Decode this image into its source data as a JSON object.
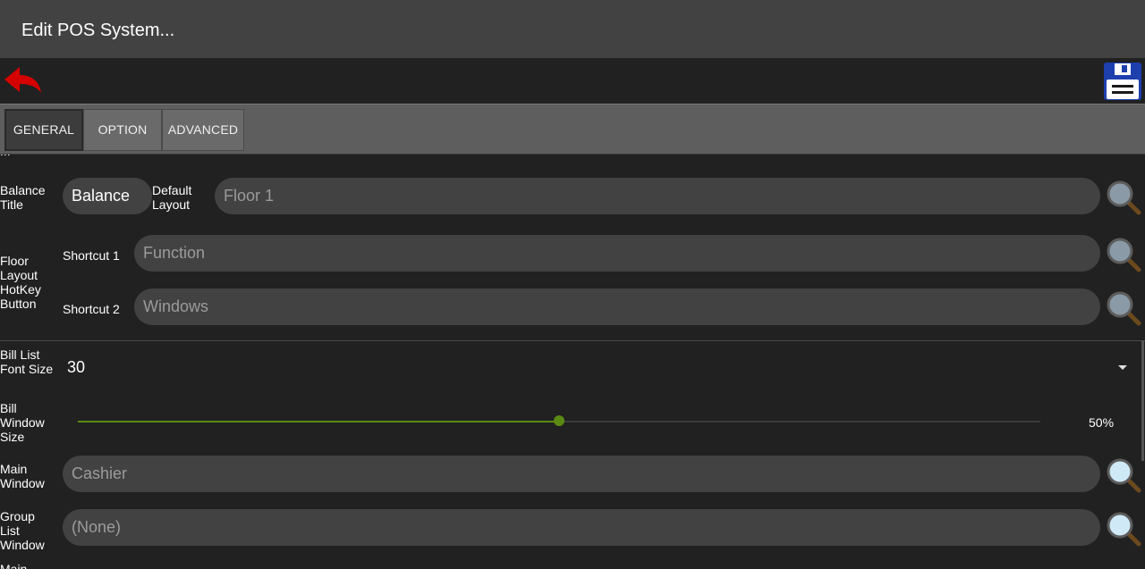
{
  "window": {
    "title": "Edit POS System..."
  },
  "toolbar": {
    "back_icon": "back-arrow-icon",
    "save_icon": "floppy-disk-icon",
    "back_color": "#d50000",
    "save_color": "#1e3fae"
  },
  "tabs": [
    {
      "label": "GENERAL",
      "active": true
    },
    {
      "label": "OPTION",
      "active": false
    },
    {
      "label": "ADVANCED",
      "active": false
    }
  ],
  "form": {
    "cut_off_text": "...",
    "balance_title": {
      "label": "Balance\nTitle",
      "value": "Balance"
    },
    "default_layout": {
      "label": "Default\nLayout",
      "placeholder": "Floor 1"
    },
    "floor_layout_hotkey": {
      "label": "Floor\nLayout\nHotKey\nButton",
      "shortcut1": {
        "label": "Shortcut 1",
        "placeholder": "Function"
      },
      "shortcut2": {
        "label": "Shortcut 2",
        "placeholder": "Windows"
      }
    },
    "bill_list_font_size": {
      "label": "Bill List\nFont Size",
      "value": "30"
    },
    "bill_window_size": {
      "label": "Bill\nWindow\nSize",
      "value_percent": 50,
      "value_text": "50%",
      "accent": "#5b8a13"
    },
    "main_window": {
      "label": "Main\nWindow",
      "placeholder": "Cashier"
    },
    "group_list_window": {
      "label": "Group\nList\nWindow",
      "placeholder": "(None)"
    },
    "next_label": "Main"
  }
}
